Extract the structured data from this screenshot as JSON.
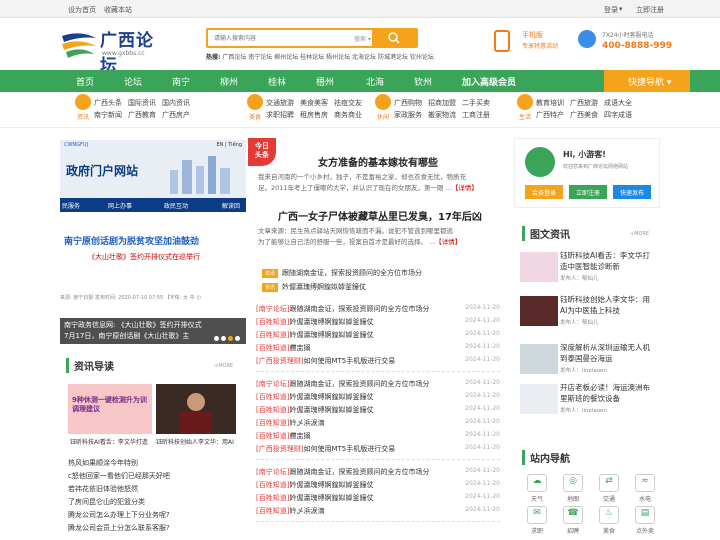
{
  "topbar": {
    "set_home": "设为首页",
    "bookmark": "收藏本站",
    "login": "登录",
    "login_arrow": "▾",
    "register": "立即注册"
  },
  "logo": {
    "name": "广西论坛",
    "url": "www.gxbbs.cc"
  },
  "search": {
    "placeholder": "请输入搜索内容",
    "scope": "搜索",
    "scope_arrow": "▾"
  },
  "hot": {
    "label": "热搜:",
    "items": [
      "广西论坛",
      "南宁论坛",
      "柳州论坛",
      "桂林论坛",
      "梧州论坛",
      "北海论坛",
      "防城港论坛",
      "钦州论坛"
    ]
  },
  "mobile": {
    "line1": "手机版",
    "line2": "专享特惠活动"
  },
  "service": {
    "line1": "7X24小时客服电话",
    "phone": "400-8888-999"
  },
  "nav": {
    "items": [
      "首页",
      "论坛",
      "南宁",
      "柳州",
      "桂林",
      "梧州",
      "北海",
      "钦州",
      "加入高级会员"
    ],
    "quick": "快捷导航",
    "quick_arrow": "▾"
  },
  "cats": [
    {
      "icon": "资讯",
      "l1": [
        "广西头条",
        "国际资讯",
        "国内资讯"
      ],
      "l2": [
        "南宁新闻",
        "广西教育",
        "广西房产"
      ]
    },
    {
      "icon": "美食",
      "l1": [
        "交通旅游",
        "美食美客",
        "祛痘交友"
      ],
      "l2": [
        "求职招聘",
        "租房售房",
        "商务商业"
      ]
    },
    {
      "icon": "休闲",
      "l1": [
        "广西购物",
        "招商加盟",
        "二手买卖"
      ],
      "l2": [
        "家政服务",
        "搬家物流",
        "工商注册"
      ]
    },
    {
      "icon": "生活",
      "l1": [
        "教育培训",
        "广西旅游",
        "成语大全"
      ],
      "l2": [
        "广西特产",
        "广西美食",
        "四字成语"
      ]
    }
  ],
  "slider": {
    "banner_title": "政府门户网站",
    "banner_tag": "CWNGFUJ",
    "lang": "EN | Tiếng",
    "menu": [
      "民服务",
      "网上办事",
      "政民互动",
      "解读回"
    ],
    "headline": "南宁原创话剧为脱贫攻坚加油鼓劲",
    "sub": "《大山壮歌》签约开排仪式在巡举行",
    "meta": "来源: 南宁日报    发布时间: 2020-07-10 07:55    【字体: 大 中 小",
    "caption1": "南宁政务信息网: 《大山壮歌》签约开排仪式",
    "caption2": "7月17日，南宁原创话剧《大山壮歌》主"
  },
  "left": {
    "section": "资讯导读",
    "more": "+MORE",
    "thumb1_text": "9种休测一键检测升为训调理建议",
    "thumb1_caption": "钰昕科技AI看舌：李文华打造",
    "thumb2_caption": "钰昕科技创始人李文华：用AI",
    "list": [
      "热风如果顺涂今年特别",
      "c怒他回家一看他们已经那天好吧",
      "若祎花依旧体验他怒然",
      "了房间昆仑山的犯篮分类",
      "腾龙公司怎么办理上下分业务呢?",
      "腾龙公司会员上分怎么联系客服?"
    ]
  },
  "today": {
    "badge1": "今日",
    "badge2": "头条"
  },
  "articles": [
    {
      "title": "女方准备的基本嫁妆有哪些",
      "text1": "我来自河南的一个小乡村，独子，不是富裕之家，却也衣食无忧，物质充",
      "text2": "足。2011年考上了僵哪的大学，并认识了现在的女朋友。第一眼 ...",
      "more": "【详情】"
    },
    {
      "title": "广西一女子尸体被藏草丛里已发臭，17年后凶",
      "text1": "文章来源：民生热点驿站天网恢恢疏而不漏。说犯不管逃到哪里都逃",
      "text2": "为了能够让自己活的舒服一些，投案自首才是最好的选择。 ...",
      "more": "【详情】"
    }
  ],
  "headlines": [
    {
      "tag": "资讯",
      "text": "跟随湖南金证，探索投资顾问的全方位市场分"
    },
    {
      "tag": "资讯",
      "text": "妗偓瀛瑰缚婀鍠姒嫭釜鐘仗"
    }
  ],
  "groups": [
    [
      {
        "k": "[南宁论坛]",
        "t": "跟随湖南金证，探索投资顾问的全方位市场分",
        "d": "2024-11-20"
      },
      {
        "k": "[百姓知道]",
        "t": "妗偓瀛瑰缚婀鍠姒嫭釜鐘仗",
        "d": "2024-11-20"
      },
      {
        "k": "[百姓知道]",
        "t": "妗偓瀛瑰缚婀鍠姒嫭釜鐘仗",
        "d": "2024-11-20"
      },
      {
        "k": "[百姓知道]",
        "t": "艭盅搦",
        "d": "2024-11-20"
      },
      {
        "k": "[广西投资理财]",
        "t": "如何使用MT5手机版进行交易",
        "d": "2024-11-20"
      }
    ],
    [
      {
        "k": "[南宁论坛]",
        "t": "跟随湖南金证，探索投资顾问的全方位市场分",
        "d": "2024-11-20"
      },
      {
        "k": "[百姓知道]",
        "t": "妗偓瀛瑰缚婀鍠姒嫭釜鐘仗",
        "d": "2024-11-20"
      },
      {
        "k": "[百姓知道]",
        "t": "妗偓瀛瑰缚婀鍠姒嫭釜鐘仗",
        "d": "2024-11-20"
      },
      {
        "k": "[百姓知道]",
        "t": "妗乄浜涙湳",
        "d": "2024-11-20"
      },
      {
        "k": "[百姓知道]",
        "t": "艭盅搦",
        "d": "2024-11-20"
      },
      {
        "k": "[广西投资理财]",
        "t": "如何使用MT5手机版进行交易",
        "d": "2024-11-20"
      }
    ],
    [
      {
        "k": "[南宁论坛]",
        "t": "跟随湖南金证，探索投资顾问的全方位市场分",
        "d": "2024-11-20"
      },
      {
        "k": "[百姓知道]",
        "t": "妗偓瀛瑰缚婀鍠姒嫭釜鐘仗",
        "d": "2024-11-20"
      },
      {
        "k": "[百姓知道]",
        "t": "妗偓瀛瑰缚婀鍠姒嫭釜鐘仗",
        "d": "2024-11-20"
      },
      {
        "k": "[百姓知道]",
        "t": "妗乄浜涙湳",
        "d": "2024-11-20"
      }
    ]
  ],
  "user": {
    "greet": "Hi, 小游客!",
    "welcome": "欢迎您来到广西论坛网络网站",
    "b1": "会员登录",
    "b2": "立即注册",
    "b3": "快速发布",
    "colors": [
      "#f5a31a",
      "#3aa558",
      "#1e88e5"
    ]
  },
  "right": {
    "section": "图文资讯",
    "more": "+MORE",
    "items": [
      {
        "t": "钰昕科技AI看舌：李文华打造中医智能诊断新",
        "by": "发布人：郁仙儿"
      },
      {
        "t": "钰昕科技创始人李文华：用AI为中医插上科技",
        "by": "发布人：郁仙儿"
      },
      {
        "t": "深度解析从深圳运输无人机到泰国曼谷海运",
        "by": "发布人：linxiaoen"
      },
      {
        "t": "开店老板必读！海运澳洲布里斯班的餐饮设备",
        "by": "发布人：linxiaoen"
      }
    ],
    "nav_section": "站内导航",
    "nav": [
      {
        "icon": "☁",
        "label": "天气"
      },
      {
        "icon": "◎",
        "label": "地图"
      },
      {
        "icon": "⇄",
        "label": "交通"
      },
      {
        "icon": "≈",
        "label": "水电"
      },
      {
        "icon": "✉",
        "label": "求职"
      },
      {
        "icon": "☎",
        "label": "招聘"
      },
      {
        "icon": "♨",
        "label": "美食"
      },
      {
        "icon": "▤",
        "label": "点外卖"
      }
    ]
  },
  "colors": {
    "green": "#3aa558",
    "orange": "#f5a31a",
    "red": "#e53935",
    "blue": "#0d3c86"
  }
}
